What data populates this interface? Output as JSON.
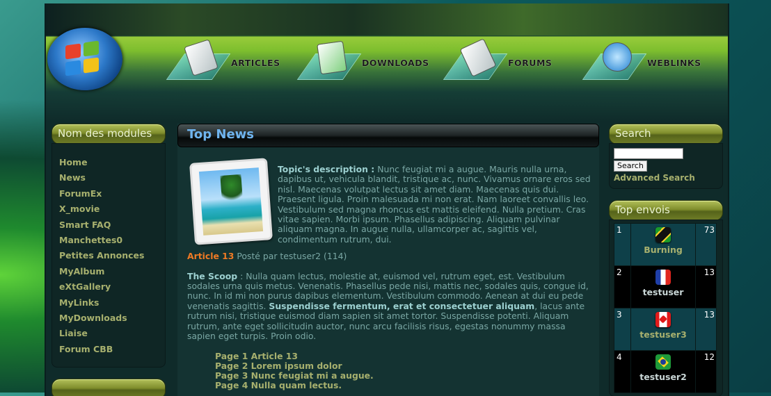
{
  "header": {
    "nav": [
      {
        "label": "ARTICLES",
        "icon": "articles-icon"
      },
      {
        "label": "DOWNLOADS",
        "icon": "downloads-icon"
      },
      {
        "label": "FORUMS",
        "icon": "forums-icon"
      },
      {
        "label": "WEBLINKS",
        "icon": "weblinks-icon"
      }
    ]
  },
  "left": {
    "title": "Nom des modules",
    "items": [
      "Home",
      "News",
      "ForumEx",
      "X_movie",
      "Smart FAQ",
      "Manchettes0",
      "Petites Annonces",
      "MyAlbum",
      "eXtGallery",
      "MyLinks",
      "MyDownloads",
      "Liaise",
      "Forum CBB"
    ]
  },
  "center": {
    "title": "Top News",
    "topic_label": "Topic's description :",
    "topic_text": " Nunc feugiat mi a augue. Mauris nulla urna, dapibus ut, vehicula blandit, tristique ac, nunc. Vivamus ornare eros sed nisl. Maecenas volutpat lectus sit amet diam. Maecenas quis dui. Praesent ligula. Proin malesuada mi non erat. Nam laoreet convallis leo. Vestibulum sed magna rhoncus est mattis eleifend. Nulla pretium. Cras vitae sapien. Morbi ipsum. Phasellus adipiscing. Aliquam pulvinar aliquam magna. In augue nulla, ullamcorper ac, sagittis vel, condimentum rutrum, dui.",
    "article_title": "Article 13",
    "posted_by": " Posté par testuser2 (114)",
    "scoop_label": "The Scoop",
    "scoop_text_1": " : Nulla quam lectus, molestie at, euismod vel, rutrum eget, est. Vestibulum sodales urna quis metus. Venenatis. Phasellus pede nisi, mattis nec, sodales quis, congue id, nunc. In id mi non purus dapibus elementum. Vestibulum commodo. Aenean at dui eu pede venenatis sagittis. ",
    "scoop_bold": "Suspendisse fermentum, erat et consectetuer aliquam",
    "scoop_text_2": ", lacus ante rutrum nisi, tristique euismod diam sapien sit amet tortor. Suspendisse potenti. Aliquam rutrum, ante eget sollicitudin auctor, nunc arcu facilisis risus, egestas nonummy massa sapien eget turpis. Proin odio.",
    "pages": [
      "Page 1 Article 13",
      "Page 2 Lorem ipsum dolor",
      "Page 3 Nunc feugiat mi a augue.",
      "Page 4 Nulla quam lectus."
    ]
  },
  "right": {
    "search_title": "Search",
    "search_button": "Search",
    "advanced": "Advanced Search",
    "top_title": "Top envois",
    "top": [
      {
        "rank": "1",
        "name": "Burning",
        "count": "73",
        "flag": "jamaica"
      },
      {
        "rank": "2",
        "name": "testuser",
        "count": "13",
        "flag": "france"
      },
      {
        "rank": "3",
        "name": "testuser3",
        "count": "13",
        "flag": "canada"
      },
      {
        "rank": "4",
        "name": "testuser2",
        "count": "12",
        "flag": "brazil"
      }
    ]
  },
  "colors": {
    "link_olive": "#a7b06e",
    "accent_orange": "#ef7a24",
    "title_blue": "#6fb4ee"
  }
}
